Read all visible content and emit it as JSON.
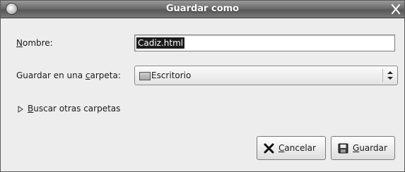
{
  "window": {
    "title": "Guardar como"
  },
  "name_field": {
    "label_mnemonic": "N",
    "label_rest": "ombre:",
    "value": "Cadiz.html"
  },
  "folder_field": {
    "label_before": "Guardar en una ",
    "label_mnemonic": "c",
    "label_after": "arpeta:",
    "selected": "Escritorio",
    "icon": "desktop-folder-icon"
  },
  "browse": {
    "mnemonic": "B",
    "label_rest": "uscar otras carpetas",
    "expanded": false
  },
  "buttons": {
    "cancel_mnemonic": "C",
    "cancel_rest": "ancelar",
    "save_mnemonic": "G",
    "save_rest": "uardar"
  }
}
